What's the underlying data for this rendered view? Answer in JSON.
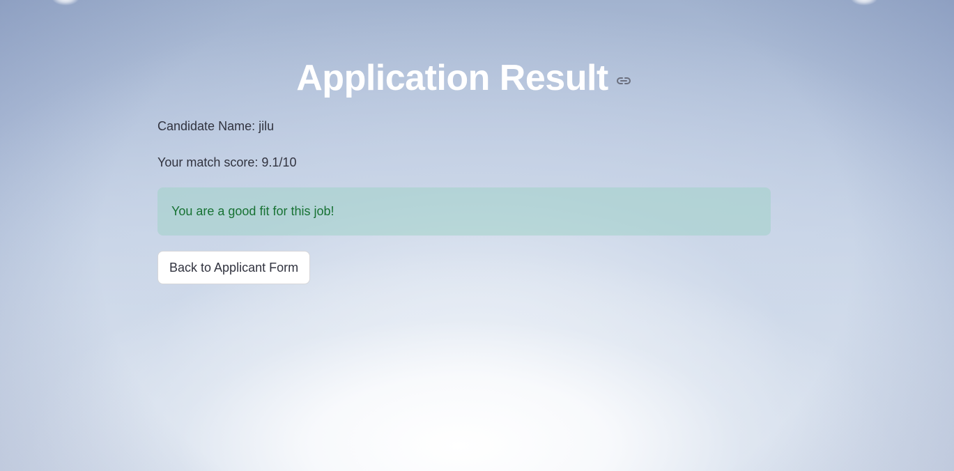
{
  "page": {
    "title": "Application Result",
    "candidate_label": "Candidate Name: jilu",
    "score_label": "Your match score: 9.1/10"
  },
  "alert": {
    "message": "You are a good fit for this job!"
  },
  "actions": {
    "back_label": "Back to Applicant Form"
  },
  "icons": {
    "anchor": "link-icon"
  },
  "colors": {
    "title": "#ffffff",
    "text": "#31333f",
    "success_text": "#177233",
    "success_bg": "#a0d2c8"
  }
}
